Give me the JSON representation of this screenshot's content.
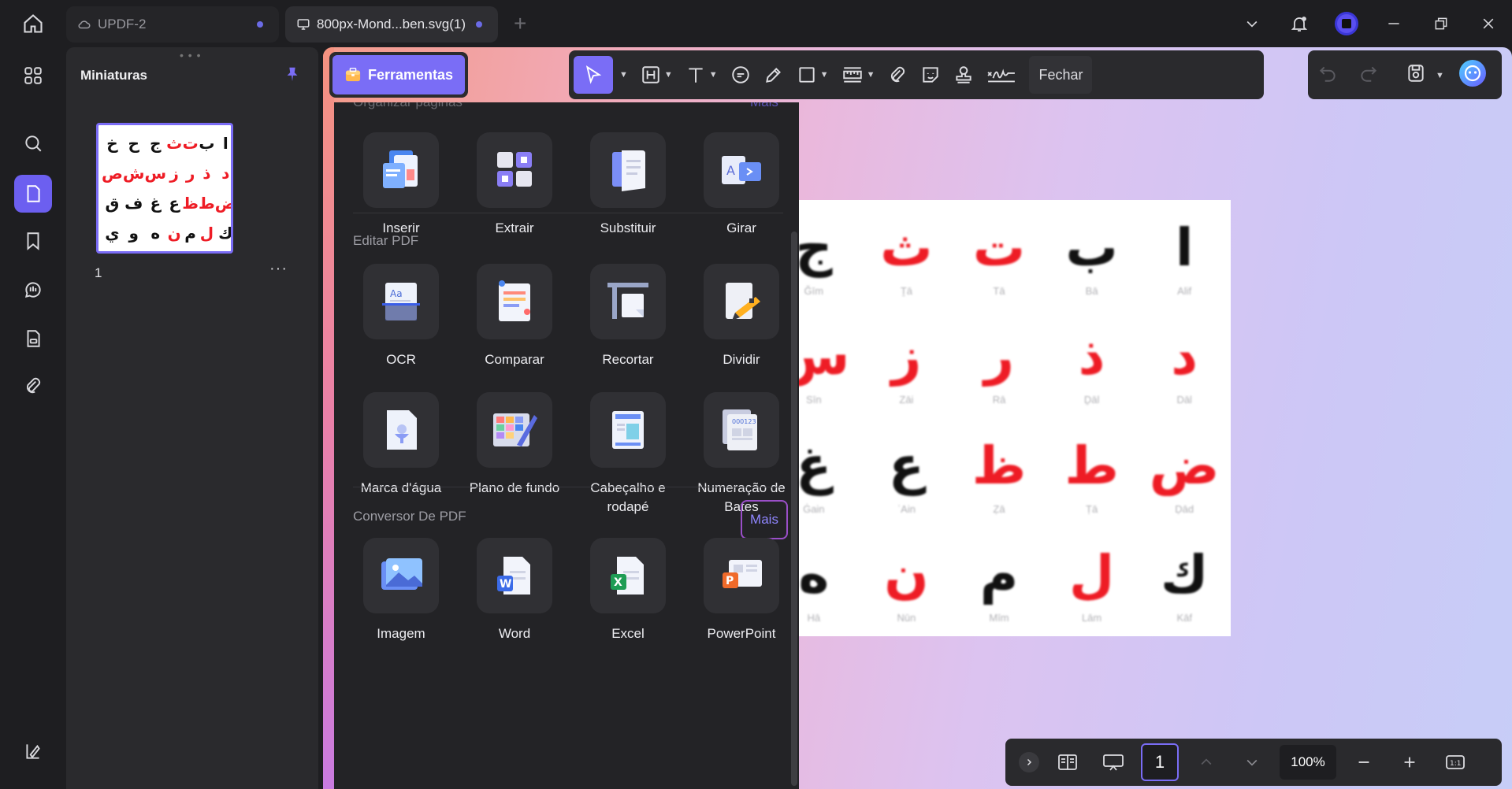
{
  "tabs": [
    {
      "label": "UPDF-2",
      "icon": "cloud-icon"
    },
    {
      "label": "800px-Mond...ben.svg(1)",
      "icon": "monitor-icon"
    }
  ],
  "thumbnails": {
    "title": "Miniaturas",
    "page_number": "1",
    "more": "···",
    "grid": [
      [
        "خ",
        "ح",
        "ج",
        "ث",
        "ت",
        "ب",
        "ا"
      ],
      [
        "ص",
        "ش",
        "س",
        "ز",
        "ر",
        "ذ",
        "د"
      ],
      [
        "ق",
        "ف",
        "غ",
        "ع",
        "ظ",
        "ط",
        "ض"
      ],
      [
        "ي",
        "و",
        "ه",
        "ن",
        "م",
        "ل",
        "ك"
      ]
    ]
  },
  "tools_button": {
    "label": "Ferramentas"
  },
  "toolbar": {
    "close_label": "Fechar"
  },
  "tools_panel": {
    "partial_section": {
      "title": "Organizar páginas",
      "more": "Mais"
    },
    "organize": [
      {
        "label": "Inserir",
        "icon": "insert-icon"
      },
      {
        "label": "Extrair",
        "icon": "extract-icon"
      },
      {
        "label": "Substituir",
        "icon": "replace-icon"
      },
      {
        "label": "Girar",
        "icon": "rotate-icon"
      }
    ],
    "edit_title": "Editar PDF",
    "edit": [
      {
        "label": "OCR",
        "icon": "ocr-icon"
      },
      {
        "label": "Comparar",
        "icon": "compare-icon"
      },
      {
        "label": "Recortar",
        "icon": "crop-icon"
      },
      {
        "label": "Dividir",
        "icon": "split-icon"
      },
      {
        "label": "Marca d'água",
        "icon": "watermark-icon"
      },
      {
        "label": "Plano de fundo",
        "icon": "background-icon"
      },
      {
        "label": "Cabeçalho e rodapé",
        "icon": "header-footer-icon"
      },
      {
        "label": "Numeração de Bates",
        "icon": "bates-icon"
      }
    ],
    "convert_title": "Conversor De PDF",
    "convert_more": "Mais",
    "convert": [
      {
        "label": "Imagem",
        "icon": "image-icon"
      },
      {
        "label": "Word",
        "icon": "word-icon"
      },
      {
        "label": "Excel",
        "icon": "excel-icon"
      },
      {
        "label": "PowerPoint",
        "icon": "powerpoint-icon"
      }
    ]
  },
  "document": {
    "cells": [
      {
        "ch": "ا",
        "name": "Alif",
        "color": "black"
      },
      {
        "ch": "ب",
        "name": "Bā",
        "color": "black"
      },
      {
        "ch": "ت",
        "name": "Tā",
        "color": "red"
      },
      {
        "ch": "ث",
        "name": "Ṯā",
        "color": "red"
      },
      {
        "ch": "ج",
        "name": "Ǧīm",
        "color": "black"
      },
      {
        "ch": "د",
        "name": "Dāl",
        "color": "red"
      },
      {
        "ch": "ذ",
        "name": "Ḏāl",
        "color": "red"
      },
      {
        "ch": "ر",
        "name": "Rā",
        "color": "red"
      },
      {
        "ch": "ز",
        "name": "Zāi",
        "color": "red"
      },
      {
        "ch": "س",
        "name": "Sīn",
        "color": "red"
      },
      {
        "ch": "ض",
        "name": "Ḍād",
        "color": "red"
      },
      {
        "ch": "ط",
        "name": "Ṭā",
        "color": "red"
      },
      {
        "ch": "ظ",
        "name": "Ẓā",
        "color": "red"
      },
      {
        "ch": "ع",
        "name": "ʿAin",
        "color": "black"
      },
      {
        "ch": "غ",
        "name": "Ġain",
        "color": "black"
      },
      {
        "ch": "ك",
        "name": "Kāf",
        "color": "black"
      },
      {
        "ch": "ل",
        "name": "Lām",
        "color": "red"
      },
      {
        "ch": "م",
        "name": "Mīm",
        "color": "black"
      },
      {
        "ch": "ن",
        "name": "Nūn",
        "color": "red"
      },
      {
        "ch": "ه",
        "name": "Hā",
        "color": "black"
      }
    ]
  },
  "bottom_bar": {
    "page": "1",
    "zoom": "100%"
  },
  "colors": {
    "accent": "#7a6df6",
    "red_letter": "#ee1c25",
    "highlight_border": "#9a4fc8"
  }
}
